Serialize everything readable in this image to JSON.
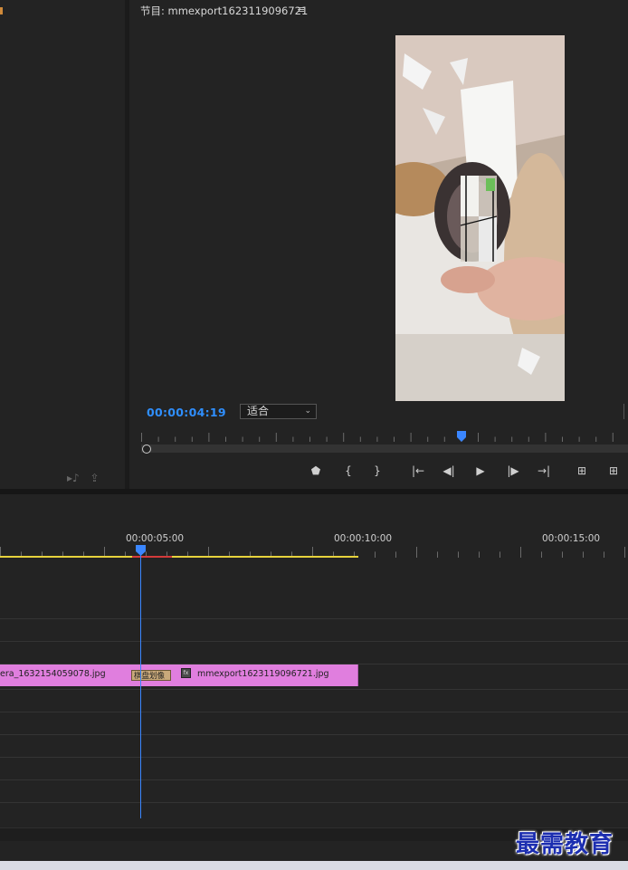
{
  "program_monitor": {
    "title": "节目: mmexport1623119096721",
    "menu_icon": "hamburger-menu-icon",
    "timecode": "00:00:04:19",
    "fit": "适合",
    "controls": [
      {
        "name": "add-marker-button",
        "icon": "marker-icon",
        "glyph": "⬟"
      },
      {
        "name": "mark-in-button",
        "icon": "mark-in-icon",
        "glyph": "{"
      },
      {
        "name": "mark-out-button",
        "icon": "mark-out-icon",
        "glyph": "}"
      },
      {
        "name": "go-to-in-button",
        "icon": "go-to-in-icon",
        "glyph": "|←"
      },
      {
        "name": "step-back-button",
        "icon": "step-back-icon",
        "glyph": "◀|"
      },
      {
        "name": "play-button",
        "icon": "play-icon",
        "glyph": "▶"
      },
      {
        "name": "step-forward-button",
        "icon": "step-forward-icon",
        "glyph": "|▶"
      },
      {
        "name": "go-to-out-button",
        "icon": "go-to-out-icon",
        "glyph": "→|"
      },
      {
        "name": "lift-button",
        "icon": "lift-icon",
        "glyph": "⊞"
      },
      {
        "name": "extract-button",
        "icon": "extract-icon",
        "glyph": "⊞"
      }
    ]
  },
  "timeline": {
    "ruler_labels": [
      "00:00:05:00",
      "00:00:10:00",
      "00:00:15:00"
    ],
    "clip_left_label": "era_1632154059078.jpg",
    "transition_label": "棋盘划像",
    "fx_label": "fx",
    "clip_right_label": "mmexport1623119096721.jpg"
  },
  "watermark": "最需教育",
  "colors": {
    "accent_blue": "#2f8fff",
    "clip_pink": "#e07ede",
    "work_area_yellow": "#e6d23c",
    "render_red": "#d43a3a"
  }
}
